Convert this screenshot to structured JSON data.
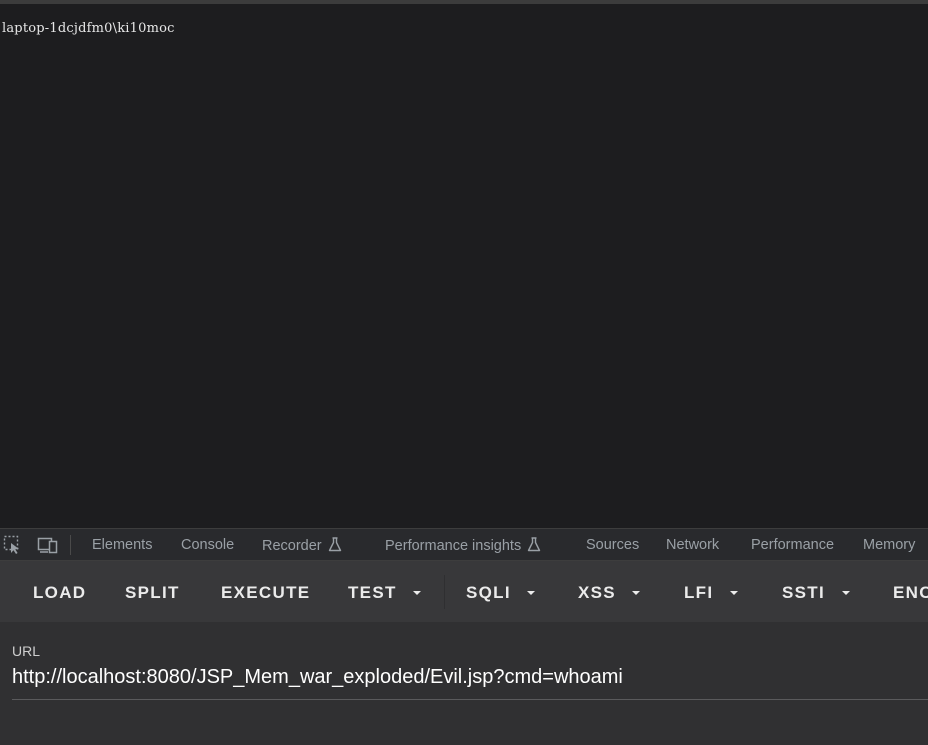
{
  "page": {
    "output_text": "laptop-1dcjdfm0\\ki10moc"
  },
  "devtools": {
    "inspect_icon": "inspect-element-icon",
    "device_icon": "device-toolbar-icon",
    "tabs": [
      {
        "label": "Elements"
      },
      {
        "label": "Console"
      },
      {
        "label": "Recorder",
        "icon": "flask-icon"
      },
      {
        "label": "Performance insights",
        "icon": "flask-icon"
      },
      {
        "label": "Sources"
      },
      {
        "label": "Network"
      },
      {
        "label": "Performance"
      },
      {
        "label": "Memory"
      }
    ]
  },
  "hackbar": {
    "buttons": [
      {
        "label": "LOAD"
      },
      {
        "label": "SPLIT"
      },
      {
        "label": "EXECUTE"
      },
      {
        "label": "TEST",
        "dropdown": true
      },
      {
        "label": "SQLI",
        "dropdown": true
      },
      {
        "label": "XSS",
        "dropdown": true
      },
      {
        "label": "LFI",
        "dropdown": true
      },
      {
        "label": "SSTI",
        "dropdown": true
      },
      {
        "label": "ENC"
      }
    ]
  },
  "url_panel": {
    "label": "URL",
    "value": "http://localhost:8080/JSP_Mem_war_exploded/Evil.jsp?cmd=whoami"
  },
  "colors": {
    "page_bg": "#1d1d1f",
    "devtools_bg": "#292a2d",
    "hackbar_bg": "#38383a",
    "url_panel_bg": "#303032"
  }
}
